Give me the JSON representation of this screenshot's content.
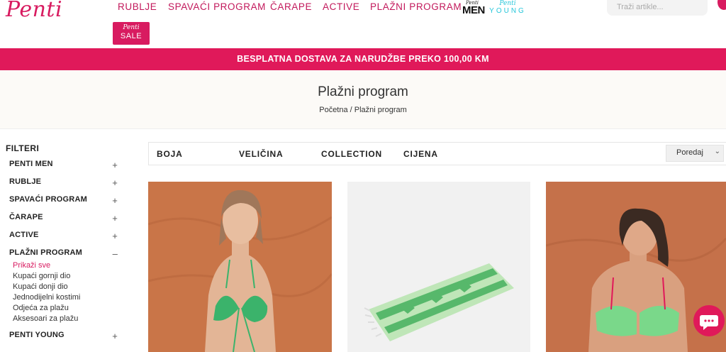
{
  "header": {
    "logo": "Penti",
    "nav": [
      "RUBLJE",
      "SPAVAĆI PROGRAM",
      "ČARAPE",
      "ACTIVE",
      "PLAŽNI PROGRAM"
    ],
    "men_logo": {
      "small": "Penti",
      "big": "MEN"
    },
    "young_logo": {
      "small": "Penti",
      "big": "YOUNG"
    },
    "sale_logo": {
      "small": "Penti",
      "big": "SALE"
    },
    "search_placeholder": "Traži artikle..."
  },
  "banner": "BESPLATNA DOSTAVA ZA NARUDŽBE PREKO 100,00 KM",
  "page": {
    "title": "Plažni program",
    "breadcrumb": {
      "home": "Početna",
      "separator": " / ",
      "current": "Plažni program"
    }
  },
  "filters": {
    "heading": "FILTERI",
    "categories": [
      {
        "label": "PENTI MEN",
        "sign": "+"
      },
      {
        "label": "RUBLJE",
        "sign": "+"
      },
      {
        "label": "SPAVAĆI PROGRAM",
        "sign": "+"
      },
      {
        "label": "ČARAPE",
        "sign": "+"
      },
      {
        "label": "ACTIVE",
        "sign": "+"
      },
      {
        "label": "PLAŽNI PROGRAM",
        "sign": "–"
      },
      {
        "label": "PENTI YOUNG",
        "sign": "+"
      }
    ],
    "subcategories": [
      "Prikaži sve",
      "Kupaći gornji dio",
      "Kupaći donji dio",
      "Jednodijelni kostimi",
      "Odjeća za plažu",
      "Aksesoari za plažu"
    ]
  },
  "filter_bar": {
    "items": [
      "BOJA",
      "VELIČINA",
      "COLLECTION",
      "CIJENA"
    ],
    "sort_label": "Poredaj"
  },
  "colors": {
    "brand": "#e0195a",
    "nav": "#c2185b",
    "accent_young": "#26c6da"
  },
  "icons": [
    "cart-icon",
    "chevron-down-icon",
    "chat-icon",
    "plus-icon",
    "minus-icon"
  ]
}
